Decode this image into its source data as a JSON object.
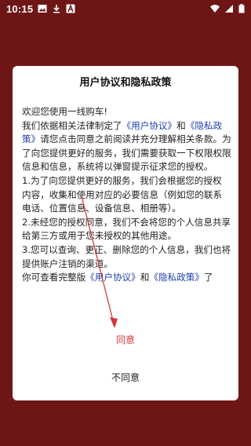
{
  "status_bar": {
    "time": "10:15",
    "left_icons": [
      "image-icon",
      "download-icon",
      "a-box-icon"
    ],
    "right_icons": [
      "wifi-icon",
      "signal-icon",
      "battery-icon"
    ]
  },
  "dialog": {
    "title": "用户协议和隐私政策",
    "greeting": "欢迎您使用一线购车!",
    "para1_before": "我们依据相关法律制定了",
    "user_agreement_link": "《用户协议》",
    "para1_and": "和",
    "privacy_policy_link": "《隐私政策》",
    "para1_after": "请您点击同意之前阅读并充分理解相关条款。为了向您提供更好的服务，我们需要获取一下权限权限信息和信息，系统将以弹窗提示征求您的授权。",
    "item1": "1.为了向您提供更好的服务，我们会根据您的授权 内容，收集和使用对应的必要信息（例如您的联系 电话、位置信息、设备信息、相册等）。",
    "item2": "2.未经您的授权同意，我们不会将您的个人信息共享给第三方或用于您未授权的其他用途。",
    "item3": "3.您可以查询、更正、删除您的个人信息，我们也将提供账户注销的渠道。",
    "footer_before": "你可查看完整版",
    "footer_user_link": "《用户协议》",
    "footer_and": "和",
    "footer_privacy_link": "《隐私政策》",
    "footer_after": "了",
    "agree_button": "同意",
    "disagree_button": "不同意"
  },
  "colors": {
    "background": "#6e1616",
    "link": "#1f3fae",
    "agree": "#d23a3a",
    "arrow": "#d23a3a"
  }
}
